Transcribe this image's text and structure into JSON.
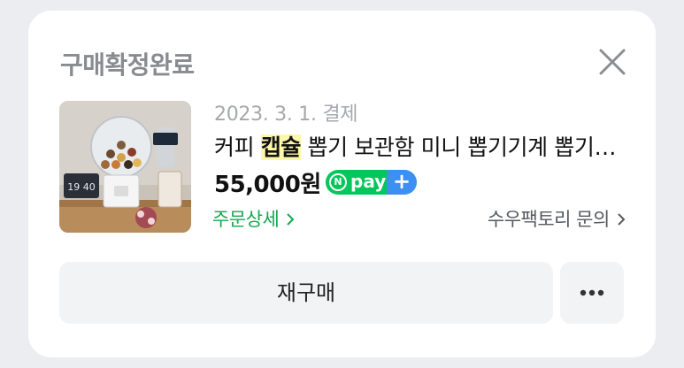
{
  "card": {
    "status_title": "구매확정완료",
    "close_icon": "close-x-icon"
  },
  "product": {
    "thumbnail_alt": "gumball capsule machine with coffee capsules and clock",
    "clock_text": "19 40",
    "pay_date": "2023. 3. 1. 결제",
    "name_prefix": "커피 ",
    "name_highlight": "캡슐",
    "name_suffix": " 뽑기 보관함 미니 뽑기기계 뽑기통 캡슐 보관",
    "price": "55,000원",
    "npay_label": "pay",
    "npay_plus": "+",
    "npay_n": "N"
  },
  "links": {
    "order_detail": "주문상세",
    "seller_inquiry": "수우팩토리 문의"
  },
  "actions": {
    "rebuy": "재구매",
    "more_icon": "more-dots-icon"
  },
  "colors": {
    "accent_green": "#14a851",
    "npay_green": "#03c75a",
    "npay_blue": "#3d8ff4",
    "highlight": "#fdf7a8"
  }
}
